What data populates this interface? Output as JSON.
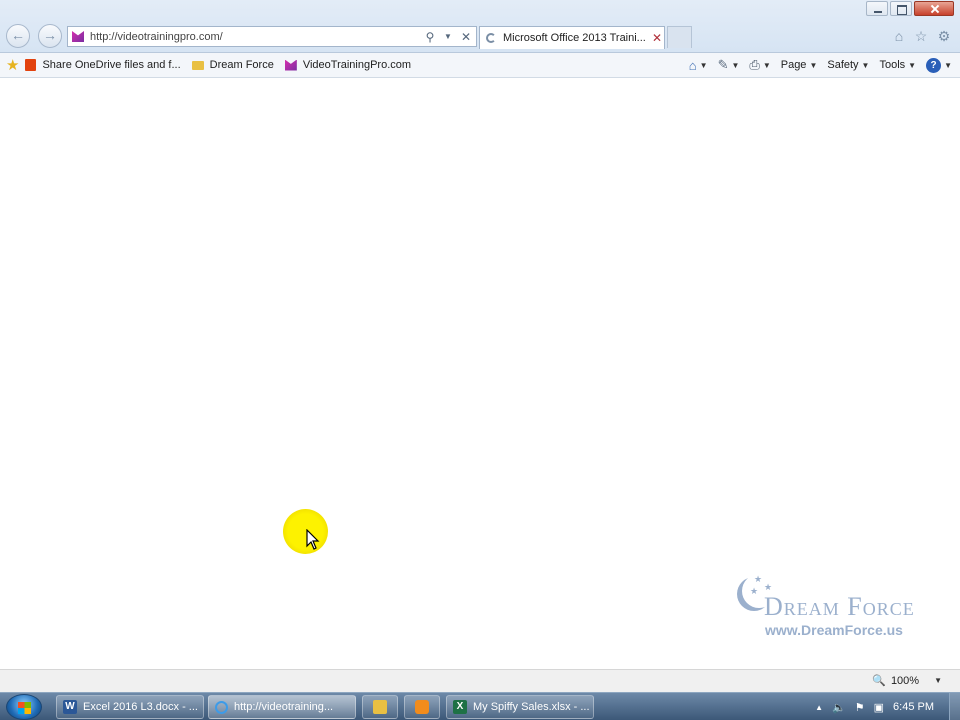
{
  "window": {
    "controls": [
      "minimize-icon",
      "maximize-icon",
      "close-icon"
    ]
  },
  "address_bar": {
    "url": "http://videotrainingpro.com/"
  },
  "tab": {
    "title": "Microsoft Office 2013 Traini..."
  },
  "favorites": {
    "items": [
      {
        "label": "Share OneDrive files and f...",
        "icon": "office-icon"
      },
      {
        "label": "Dream Force",
        "icon": "folder-icon"
      },
      {
        "label": "VideoTrainingPro.com",
        "icon": "site-favicon"
      }
    ]
  },
  "commands": {
    "page": "Page",
    "safety": "Safety",
    "tools": "Tools",
    "help": "?"
  },
  "watermark": {
    "brand": "Dream Force",
    "url": "www.DreamForce.us"
  },
  "status": {
    "zoom": "100%"
  },
  "taskbar": {
    "items": [
      {
        "label": "Excel 2016 L3.docx - ...",
        "icon": "W"
      },
      {
        "label": "http://videotraining...",
        "icon": ""
      },
      {
        "label": "My Spiffy Sales.xlsx - ...",
        "icon": "X"
      }
    ],
    "clock": "6:45 PM"
  }
}
